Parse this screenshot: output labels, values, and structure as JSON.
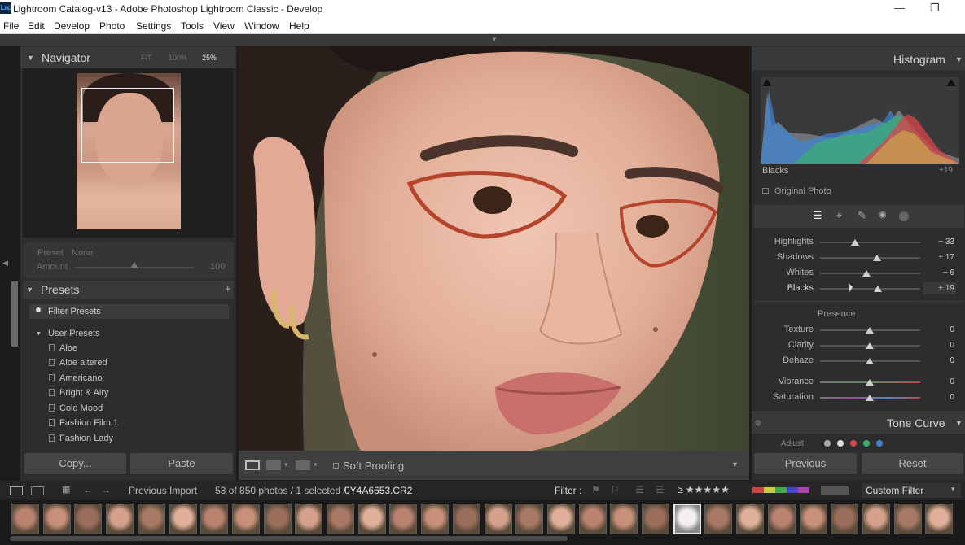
{
  "window": {
    "title": "Lightroom Catalog-v13 - Adobe Photoshop Lightroom Classic - Develop",
    "app_icon": "Lrc"
  },
  "menu": [
    "File",
    "Edit",
    "Develop",
    "Photo",
    "Settings",
    "Tools",
    "View",
    "Window",
    "Help"
  ],
  "navigator": {
    "title": "Navigator",
    "zoom_options": [
      "FIT",
      "100%",
      "25%"
    ],
    "preset_label": "Preset",
    "preset_value": "None",
    "amount_label": "Amount",
    "amount_value": "100"
  },
  "presets": {
    "title": "Presets",
    "filter_label": "Filter Presets",
    "group": "User Presets",
    "items": [
      "Aloe",
      "Aloe altered",
      "Americano",
      "Bright & Airy",
      "Cold Mood",
      "Fashion Film 1",
      "Fashion Lady"
    ]
  },
  "left_buttons": {
    "copy": "Copy...",
    "paste": "Paste"
  },
  "toolbar": {
    "soft_proofing": "Soft Proofing"
  },
  "histogram": {
    "title": "Histogram",
    "readout_label": "Blacks",
    "readout_value": "+19",
    "original_photo": "Original Photo"
  },
  "tone_sliders": [
    {
      "label": "Highlights",
      "value": "− 33",
      "pos": 0.36
    },
    {
      "label": "Shadows",
      "value": "+ 17",
      "pos": 0.58
    },
    {
      "label": "Whites",
      "value": "− 6",
      "pos": 0.47
    },
    {
      "label": "Blacks",
      "value": "+ 19",
      "pos": 0.59
    }
  ],
  "presence": {
    "title": "Presence",
    "sliders": [
      {
        "label": "Texture",
        "value": "0",
        "pos": 0.5
      },
      {
        "label": "Clarity",
        "value": "0",
        "pos": 0.5
      },
      {
        "label": "Dehaze",
        "value": "0",
        "pos": 0.5
      },
      {
        "label": "Vibrance",
        "value": "0",
        "pos": 0.5
      },
      {
        "label": "Saturation",
        "value": "0",
        "pos": 0.5
      }
    ]
  },
  "tone_curve": {
    "title": "Tone Curve",
    "adjust": "Adjust"
  },
  "right_buttons": {
    "previous": "Previous",
    "reset": "Reset"
  },
  "filmbar": {
    "source": "Previous Import",
    "count": "53 of 850 photos / 1 selected /",
    "filename": "0Y4A6653.CR2",
    "filter_label": "Filter :",
    "stars": "≥ ★★★★★",
    "custom_filter": "Custom Filter"
  },
  "filmstrip": {
    "count": 30,
    "selected_index": 21
  },
  "colors": {
    "accent": "#d8d8d8",
    "panel": "#2d2d2d",
    "red": "#d8454a",
    "green": "#39b06f",
    "blue": "#3d86d8"
  }
}
